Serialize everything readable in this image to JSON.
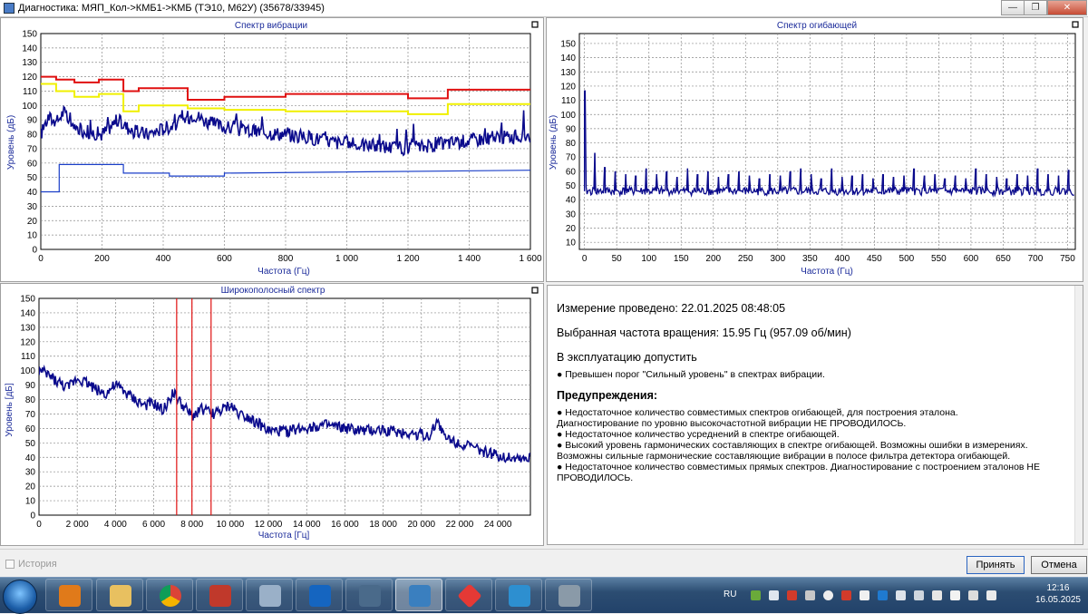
{
  "window": {
    "title": "Диагностика: МЯП_Кол->КМБ1->КМБ (ТЭ10, М62У) (35678/33945)",
    "buttons": [
      "minimize",
      "maximize",
      "close"
    ]
  },
  "charts": {
    "vibration": {
      "title": "Спектр вибрации",
      "xlabel": "Частота (Гц)",
      "ylabel": "Уровень (дБ)",
      "xticks": [
        "0",
        "200",
        "400",
        "600",
        "800",
        "1 000",
        "1 200",
        "1 400",
        "1 600"
      ],
      "yticks": [
        "0",
        "10",
        "20",
        "30",
        "40",
        "50",
        "60",
        "70",
        "80",
        "90",
        "100",
        "110",
        "120",
        "130",
        "140",
        "150"
      ]
    },
    "envelope": {
      "title": "Спектр огибающей",
      "xlabel": "Частота (Гц)",
      "ylabel": "Уровень (дБ)",
      "xticks": [
        "0",
        "50",
        "100",
        "150",
        "200",
        "250",
        "300",
        "350",
        "400",
        "450",
        "500",
        "550",
        "600",
        "650",
        "700",
        "750"
      ],
      "yticks": [
        "10",
        "20",
        "30",
        "40",
        "50",
        "60",
        "70",
        "80",
        "90",
        "100",
        "110",
        "120",
        "130",
        "140",
        "150"
      ]
    },
    "broadband": {
      "title": "Широкополосный спектр",
      "xlabel": "Частота [Гц]",
      "ylabel": "Уровень [дБ]",
      "xticks": [
        "0",
        "2 000",
        "4 000",
        "6 000",
        "8 000",
        "10 000",
        "12 000",
        "14 000",
        "16 000",
        "18 000",
        "20 000",
        "22 000",
        "24 000"
      ],
      "yticks": [
        "0",
        "10",
        "20",
        "30",
        "40",
        "50",
        "60",
        "70",
        "80",
        "90",
        "100",
        "110",
        "120",
        "130",
        "140",
        "150"
      ]
    }
  },
  "chart_data": [
    {
      "type": "line",
      "title": "Спектр вибрации",
      "xlabel": "Частота (Гц)",
      "ylabel": "Уровень (дБ)",
      "xlim": [
        0,
        1600
      ],
      "ylim": [
        0,
        150
      ],
      "grid": true,
      "series": [
        {
          "color": "#e01010",
          "x": [
            0,
            50,
            50,
            110,
            110,
            190,
            190,
            270,
            270,
            320,
            320,
            480,
            480,
            600,
            600,
            800,
            800,
            1200,
            1200,
            1330,
            1330,
            1600
          ],
          "y": [
            120,
            120,
            118,
            118,
            116,
            116,
            118,
            118,
            110,
            110,
            112,
            112,
            104,
            104,
            106,
            106,
            108,
            108,
            105,
            105,
            111,
            111
          ]
        },
        {
          "color": "#f0f000",
          "x": [
            0,
            50,
            50,
            110,
            110,
            190,
            190,
            270,
            270,
            320,
            320,
            480,
            480,
            600,
            600,
            800,
            800,
            1200,
            1200,
            1330,
            1330,
            1600
          ],
          "y": [
            115,
            115,
            110,
            110,
            106,
            106,
            108,
            108,
            96,
            96,
            100,
            100,
            98,
            98,
            97,
            97,
            96,
            96,
            94,
            94,
            101,
            101
          ]
        },
        {
          "color": "#1a3ec8",
          "x": [
            0,
            8,
            8,
            60,
            60,
            270,
            270,
            420,
            420,
            600,
            600,
            1600
          ],
          "y": [
            40,
            40,
            40,
            40,
            59,
            59,
            53,
            53,
            51,
            51,
            53,
            55
          ]
        },
        {
          "color": "#0a0a8c",
          "x": [
            0,
            25,
            50,
            75,
            100,
            150,
            200,
            250,
            300,
            350,
            400,
            450,
            500,
            550,
            600,
            650,
            700,
            800,
            900,
            1000,
            1100,
            1200,
            1300,
            1400,
            1500,
            1600
          ],
          "y": [
            80,
            92,
            88,
            96,
            85,
            82,
            80,
            90,
            82,
            80,
            84,
            88,
            94,
            88,
            85,
            83,
            82,
            80,
            77,
            73,
            72,
            70,
            73,
            76,
            78,
            79
          ]
        }
      ]
    },
    {
      "type": "line",
      "title": "Спектр огибающей",
      "xlabel": "Частота (Гц)",
      "ylabel": "Уровень (дБ)",
      "xlim": [
        -8,
        762
      ],
      "ylim": [
        5,
        157
      ],
      "grid": true,
      "series": [
        {
          "color": "#0a0a8c",
          "baseline": 46,
          "peaks": [
            [
              0,
              117
            ],
            [
              16,
              73
            ],
            [
              32,
              63
            ],
            [
              48,
              60
            ],
            [
              64,
              58
            ],
            [
              80,
              57
            ],
            [
              96,
              62
            ],
            [
              112,
              58
            ],
            [
              128,
              60
            ],
            [
              144,
              56
            ],
            [
              160,
              62
            ],
            [
              176,
              58
            ],
            [
              192,
              60
            ],
            [
              208,
              56
            ],
            [
              224,
              58
            ],
            [
              240,
              60
            ],
            [
              256,
              57
            ],
            [
              272,
              55
            ],
            [
              288,
              58
            ],
            [
              304,
              57
            ],
            [
              320,
              60
            ],
            [
              336,
              62
            ],
            [
              352,
              58
            ],
            [
              368,
              55
            ],
            [
              384,
              62
            ],
            [
              400,
              56
            ],
            [
              416,
              57
            ],
            [
              432,
              58
            ],
            [
              448,
              55
            ],
            [
              464,
              58
            ],
            [
              480,
              56
            ],
            [
              496,
              57
            ],
            [
              512,
              62
            ],
            [
              528,
              57
            ],
            [
              544,
              58
            ],
            [
              560,
              55
            ],
            [
              576,
              57
            ],
            [
              592,
              55
            ],
            [
              608,
              62
            ],
            [
              624,
              58
            ],
            [
              640,
              56
            ],
            [
              656,
              55
            ],
            [
              672,
              58
            ],
            [
              688,
              57
            ],
            [
              704,
              62
            ],
            [
              720,
              58
            ],
            [
              736,
              57
            ],
            [
              752,
              61
            ]
          ]
        }
      ]
    },
    {
      "type": "line",
      "title": "Широкополосный спектр",
      "xlabel": "Частота [Гц]",
      "ylabel": "Уровень [дБ]",
      "xlim": [
        0,
        25700
      ],
      "ylim": [
        0,
        150
      ],
      "grid": true,
      "markers_x": [
        7200,
        8000,
        9000
      ],
      "series": [
        {
          "color": "#0a0a8c",
          "x": [
            0,
            500,
            1000,
            1500,
            2000,
            2500,
            3000,
            3500,
            4000,
            4500,
            5000,
            5500,
            6000,
            6500,
            7000,
            7500,
            8000,
            8500,
            9000,
            9500,
            10000,
            10500,
            11000,
            11500,
            12000,
            13000,
            14000,
            15000,
            16000,
            17000,
            18000,
            19000,
            20000,
            20500,
            20800,
            21200,
            22000,
            23000,
            24000,
            25000,
            25700
          ],
          "y": [
            100,
            97,
            92,
            88,
            95,
            92,
            87,
            84,
            90,
            85,
            80,
            76,
            77,
            72,
            85,
            76,
            68,
            74,
            70,
            72,
            76,
            70,
            68,
            63,
            58,
            58,
            61,
            62,
            60,
            58,
            59,
            57,
            56,
            55,
            67,
            54,
            50,
            45,
            41,
            40,
            39
          ]
        }
      ]
    }
  ],
  "report": {
    "measured": "Измерение проведено: 22.01.2025 08:48:05",
    "speed": "Выбранная частота вращения: 15.95 Гц  (957.09 об/мин)",
    "verdict": "В эксплуатацию допустить",
    "verdict_items": [
      "Превышен порог \"Сильный уровень\" в спектрах вибрации."
    ],
    "warnings_title": "Предупреждения:",
    "warnings": [
      {
        "bullet": true,
        "text": "Недостаточное количество совместимых спектров огибающей, для построения эталона."
      },
      {
        "bullet": false,
        "text": "Диагностирование по уровню высокочастотной вибрации НЕ ПРОВОДИЛОСЬ."
      },
      {
        "bullet": true,
        "text": "Недостаточное количество усреднений в спектре огибающей."
      },
      {
        "bullet": true,
        "text": "Высокий уровень гармонических составляющих в спектре огибающей. Возможны ошибки в измерениях."
      },
      {
        "bullet": false,
        "text": "Возможны сильные гармонические составляющие вибрации в полосе фильтра детектора огибающей."
      },
      {
        "bullet": true,
        "text": "Недостаточное количество совместимых прямых спектров. Диагностирование с построением эталонов НЕ"
      },
      {
        "bullet": false,
        "text": "ПРОВОДИЛОСЬ."
      }
    ]
  },
  "bottom": {
    "history_label": "История",
    "accept_label": "Принять",
    "cancel_label": "Отмена"
  },
  "taskbar": {
    "lang": "RU",
    "time": "12:16",
    "date": "16.05.2025",
    "apps": [
      "start-orb",
      "media-player",
      "file-explorer",
      "chrome",
      "ccleaner",
      "database-app",
      "outlook",
      "calculator",
      "diagnostics-app",
      "anydesk",
      "scanner-app",
      "tools-app"
    ]
  }
}
